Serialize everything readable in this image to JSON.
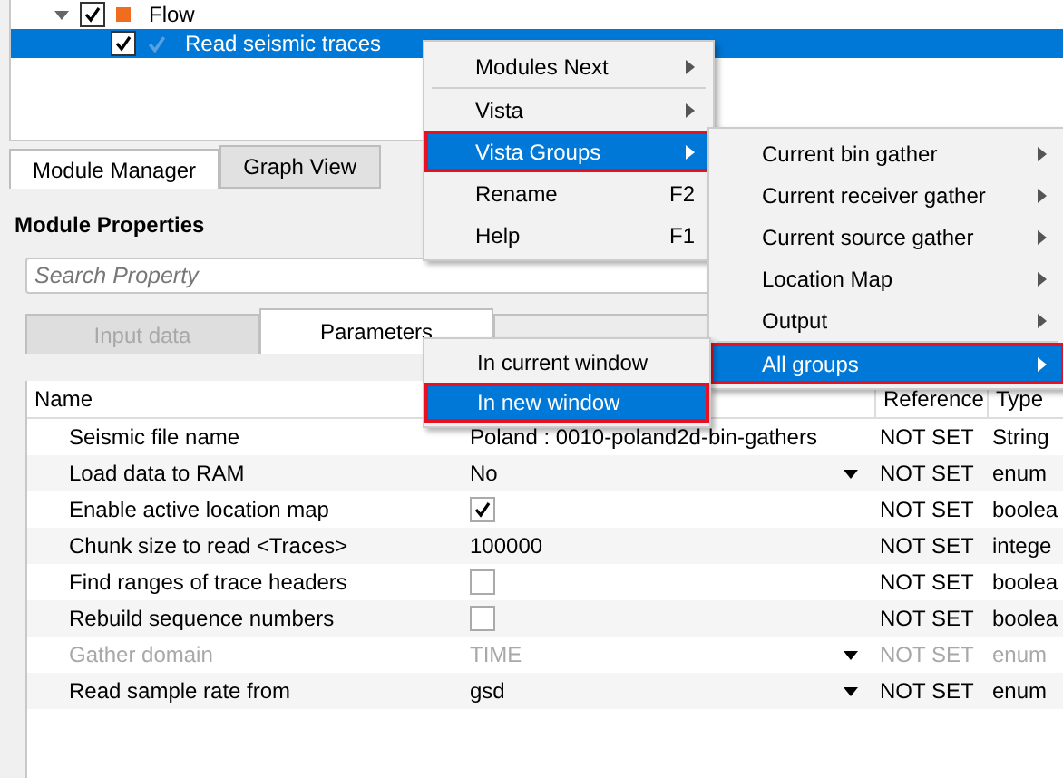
{
  "tree": [
    {
      "label": "Flow",
      "checked": true,
      "expanded": true,
      "selected": false,
      "children": [
        {
          "label": "Read seismic traces",
          "checked": true,
          "selected": true
        }
      ]
    }
  ],
  "tabs": [
    {
      "label": "Module Manager",
      "selected": true
    },
    {
      "label": "Graph View",
      "selected": false
    }
  ],
  "panel_title": "Module Properties",
  "search": {
    "placeholder": "Search Property"
  },
  "property_tabs": [
    {
      "label": "Input data",
      "selected": false,
      "disabled": true
    },
    {
      "label": "Parameters",
      "selected": true,
      "disabled": false
    },
    {
      "selected": false,
      "disabled": false
    }
  ],
  "table": {
    "columns": [
      "Name",
      "Reference",
      "Type"
    ],
    "rows": [
      {
        "name": "Seismic file name",
        "kind": "text",
        "value": "Poland : 0010-poland2d-bin-gathers",
        "reference": "NOT SET",
        "type": "String",
        "disabled": false
      },
      {
        "name": "Load data to RAM",
        "kind": "enum",
        "value": "No",
        "reference": "NOT SET",
        "type": "enum",
        "disabled": false
      },
      {
        "name": "Enable active location map",
        "kind": "check",
        "checked": true,
        "reference": "NOT SET",
        "type": "boolea",
        "disabled": false
      },
      {
        "name": "Chunk size to read <Traces>",
        "kind": "text",
        "value": "100000",
        "reference": "NOT SET",
        "type": "intege",
        "disabled": false
      },
      {
        "name": "Find ranges of trace headers",
        "kind": "check",
        "checked": false,
        "reference": "NOT SET",
        "type": "boolea",
        "disabled": false
      },
      {
        "name": "Rebuild sequence numbers",
        "kind": "check",
        "checked": false,
        "reference": "NOT SET",
        "type": "boolea",
        "disabled": false
      },
      {
        "name": "Gather domain",
        "kind": "enum",
        "value": "TIME",
        "reference": "NOT SET",
        "type": "enum",
        "disabled": true
      },
      {
        "name": "Read sample rate from",
        "kind": "enum",
        "value": "gsd",
        "reference": "NOT SET",
        "type": "enum",
        "disabled": false
      }
    ]
  },
  "context_menu": [
    {
      "label": "Modules Next",
      "submenu": true,
      "selected": false,
      "marked": false,
      "separator_after": true
    },
    {
      "label": "Vista",
      "submenu": true,
      "selected": false,
      "marked": false,
      "separator_after": false
    },
    {
      "label": "Vista Groups",
      "submenu": true,
      "selected": true,
      "marked": true,
      "separator_after": false
    },
    {
      "label": "Rename",
      "shortcut": "F2",
      "submenu": false,
      "selected": false,
      "marked": false,
      "separator_after": false
    },
    {
      "label": "Help",
      "shortcut": "F1",
      "submenu": false,
      "selected": false,
      "marked": false,
      "separator_after": false
    }
  ],
  "groups_menu": [
    {
      "label": "Current bin gather",
      "submenu": true,
      "selected": false,
      "marked": false,
      "separator_after": false
    },
    {
      "label": "Current receiver gather",
      "submenu": true,
      "selected": false,
      "marked": false,
      "separator_after": false
    },
    {
      "label": "Current source gather",
      "submenu": true,
      "selected": false,
      "marked": false,
      "separator_after": false
    },
    {
      "label": "Location Map",
      "submenu": true,
      "selected": false,
      "marked": false,
      "separator_after": false
    },
    {
      "label": "Output",
      "submenu": true,
      "selected": false,
      "marked": false,
      "separator_after": true
    },
    {
      "label": "All groups",
      "submenu": true,
      "selected": true,
      "marked": true,
      "separator_after": false
    }
  ],
  "window_menu": [
    {
      "label": "In current window",
      "submenu": false,
      "selected": false,
      "marked": false,
      "separator_after": false
    },
    {
      "label": "In new window",
      "submenu": false,
      "selected": true,
      "marked": true,
      "separator_after": false
    }
  ]
}
